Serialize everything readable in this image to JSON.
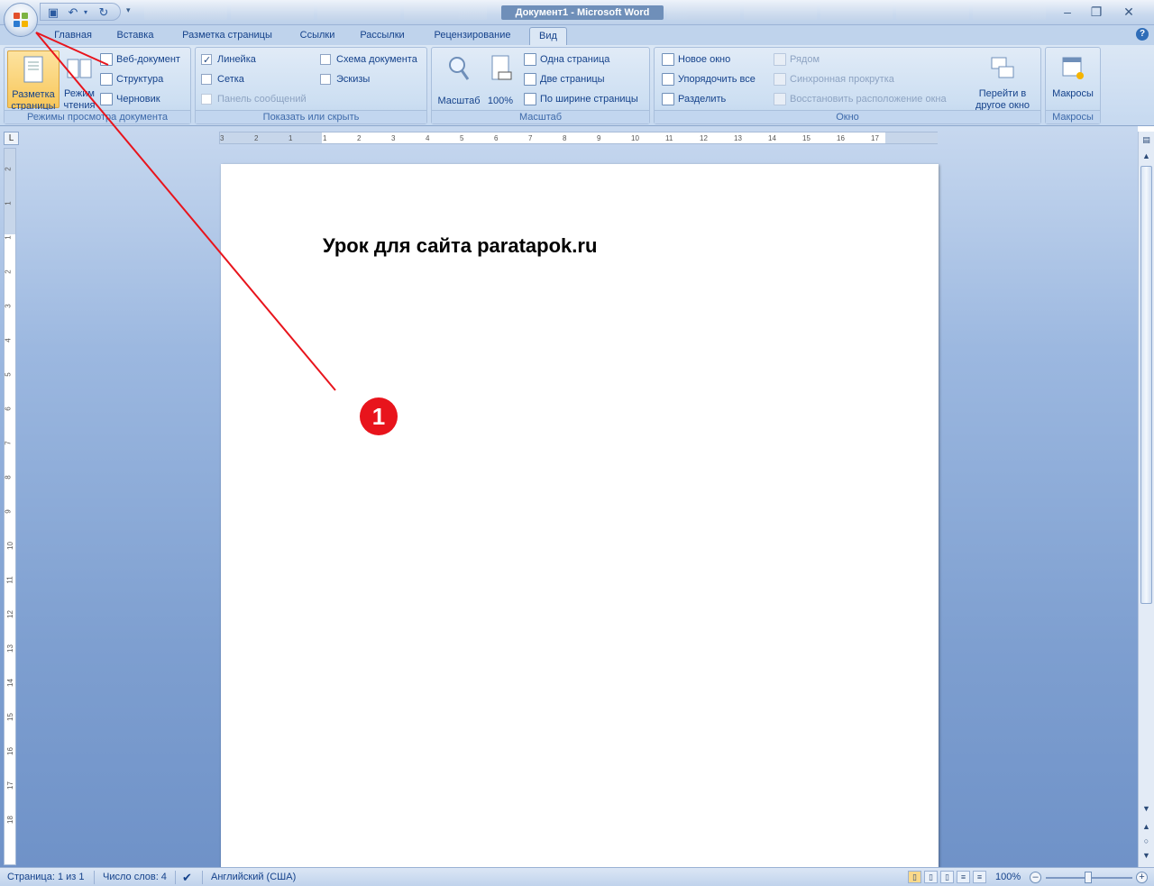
{
  "window": {
    "title": "Документ1 - Microsoft Word",
    "controls": {
      "minimize": "–",
      "restore": "❐",
      "close": "✕"
    }
  },
  "qat": {
    "more": "▾"
  },
  "tabs": [
    {
      "label": "Главная"
    },
    {
      "label": "Вставка"
    },
    {
      "label": "Разметка страницы"
    },
    {
      "label": "Ссылки"
    },
    {
      "label": "Рассылки"
    },
    {
      "label": "Рецензирование"
    },
    {
      "label": "Вид",
      "active": true
    }
  ],
  "help": "?",
  "ribbon": {
    "views": {
      "label": "Режимы просмотра документа",
      "print_layout": "Разметка страницы",
      "reading": "Режим чтения",
      "web": "Веб-документ",
      "outline": "Структура",
      "draft": "Черновик"
    },
    "show": {
      "label": "Показать или скрыть",
      "ruler": "Линейка",
      "grid": "Сетка",
      "message_bar": "Панель сообщений",
      "doc_map": "Схема документа",
      "thumbnails": "Эскизы"
    },
    "zoom": {
      "label": "Масштаб",
      "zoom": "Масштаб",
      "percent": "100%",
      "one_page": "Одна страница",
      "two_pages": "Две страницы",
      "page_width": "По ширине страницы"
    },
    "window": {
      "label": "Окно",
      "new_window": "Новое окно",
      "arrange_all": "Упорядочить все",
      "split": "Разделить",
      "side_by_side": "Рядом",
      "sync_scroll": "Синхронная прокрутка",
      "reset_position": "Восстановить расположение окна",
      "switch_windows_1": "Перейти в",
      "switch_windows_2": "другое окно"
    },
    "macros": {
      "label": "Макросы",
      "button": "Макросы"
    }
  },
  "ruler": {
    "corner": "L",
    "h_ticks": [
      "3",
      "2",
      "1",
      "1",
      "2",
      "3",
      "4",
      "5",
      "6",
      "7",
      "8",
      "9",
      "10",
      "11",
      "12",
      "13",
      "14",
      "15",
      "16",
      "17"
    ],
    "v_ticks": [
      "2",
      "1",
      "1",
      "2",
      "3",
      "4",
      "5",
      "6",
      "7",
      "8",
      "9",
      "10",
      "11",
      "12",
      "13",
      "14",
      "15",
      "16",
      "17",
      "18"
    ]
  },
  "document": {
    "text": "Урок для сайта paratapok.ru"
  },
  "status": {
    "page": "Страница: 1 из 1",
    "words": "Число слов: 4",
    "language": "Английский (США)",
    "zoom": "100%"
  },
  "annotation": {
    "badge": "1",
    "color": "#e8141c"
  }
}
